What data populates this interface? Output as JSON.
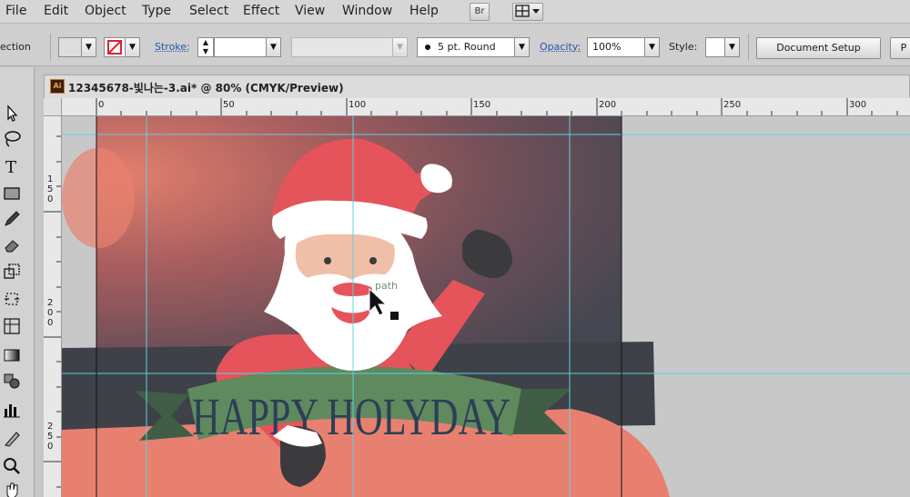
{
  "menubar": {
    "items": [
      "File",
      "Edit",
      "Object",
      "Type",
      "Select",
      "Effect",
      "View",
      "Window",
      "Help"
    ],
    "bridge_button": "Br",
    "arrange_icon": "arrange-documents-icon"
  },
  "controlbar": {
    "section_label": "ection",
    "stroke_label": "Stroke:",
    "brush_value": "5 pt. Round",
    "opacity_label": "Opacity:",
    "opacity_value": "100%",
    "style_label": "Style:",
    "document_setup_label": "Document Setup",
    "preferences_label": "P"
  },
  "document": {
    "title": "12345678-빛나는-3.ai* @ 80% (CMYK/Preview)",
    "file_badge": "Ai"
  },
  "rulers": {
    "h_labels": [
      "0",
      "50",
      "100",
      "150",
      "200",
      "250",
      "300"
    ],
    "v_labels": [
      "1\n5\n0",
      "2\n0\n0",
      "2\n5\n0"
    ]
  },
  "artwork": {
    "banner_text": "HAPPY HOLYDAY",
    "hover_hint": "path"
  },
  "colors": {
    "guide": "#5fd0e0",
    "santa_red": "#e5545a",
    "banner_green": "#5f8a5e",
    "banner_dark": "#3f5e45",
    "text_navy": "#2c3f56",
    "bg_dark": "#3e4148",
    "sack": "#e88070"
  }
}
